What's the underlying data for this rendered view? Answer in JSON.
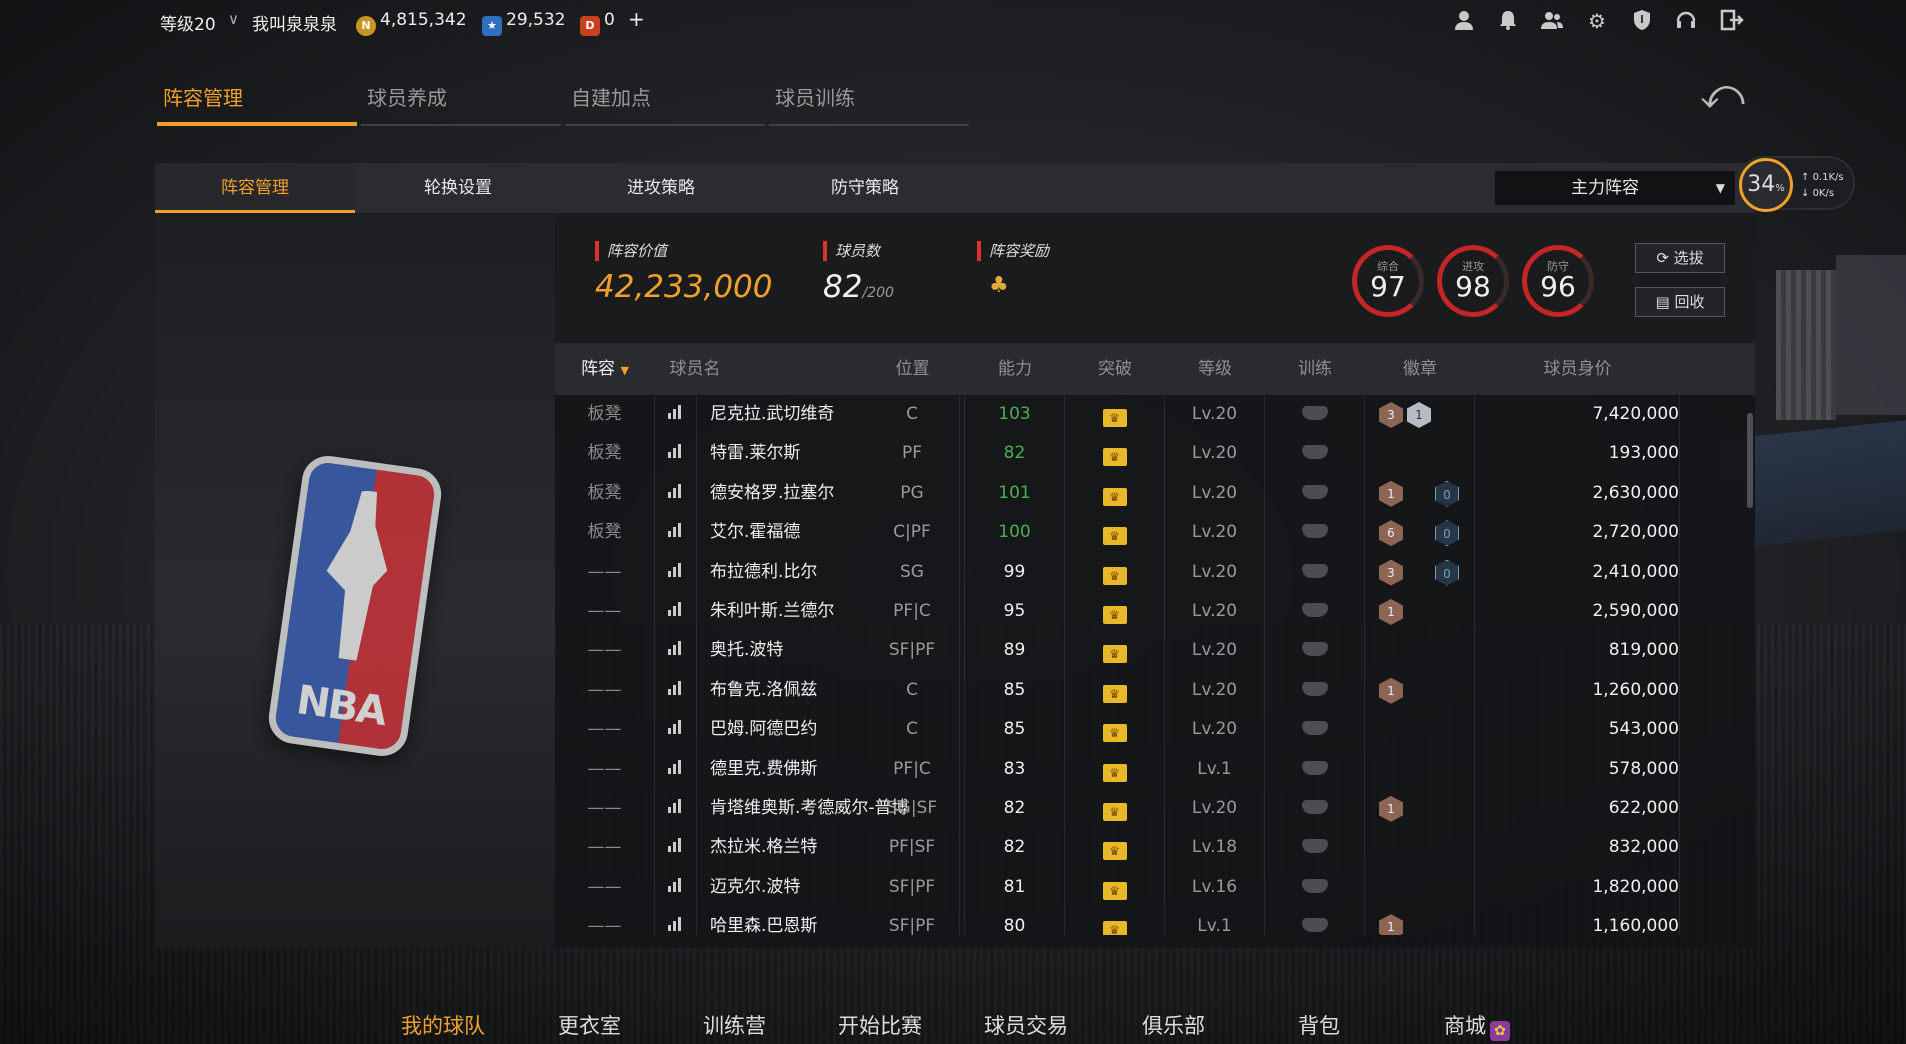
{
  "topbar": {
    "level": "等级20",
    "rank_icon": "chevron-rank-icon",
    "username": "我叫泉泉泉",
    "coins": "4,815,342",
    "stars": "29,532",
    "tickets": "0",
    "plus": "+"
  },
  "main_tabs": [
    "阵容管理",
    "球员养成",
    "自建加点",
    "球员训练"
  ],
  "sub_tabs": [
    "阵容管理",
    "轮换设置",
    "进攻策略",
    "防守策略"
  ],
  "lineup_select": "主力阵容",
  "stats": {
    "value_label": "阵容价值",
    "value": "42,233,000",
    "count_label": "球员数",
    "count": "82",
    "count_max": "/200",
    "reward_label": "阵容奖励"
  },
  "rings": [
    {
      "label": "综合",
      "value": "97"
    },
    {
      "label": "进攻",
      "value": "98"
    },
    {
      "label": "防守",
      "value": "96"
    }
  ],
  "buttons": {
    "pick": "选拔",
    "recycle": "回收"
  },
  "net": {
    "percent": "34",
    "unit": "%",
    "up": "0.1K/s",
    "down": "0K/s"
  },
  "table": {
    "headers": [
      "阵容",
      "球员名",
      "位置",
      "能力",
      "突破",
      "等级",
      "训练",
      "徽章",
      "球员身价"
    ]
  },
  "players": [
    {
      "role": "板凳",
      "name": "尼克拉.武切维奇",
      "pos": "C",
      "ability": "103",
      "green": true,
      "level": "Lv.20",
      "badges": [
        [
          "bronze",
          "3"
        ],
        [
          "silver",
          "1"
        ]
      ],
      "price": "7,420,000"
    },
    {
      "role": "板凳",
      "name": "特雷.莱尔斯",
      "pos": "PF",
      "ability": "82",
      "green": true,
      "level": "Lv.20",
      "badges": [],
      "price": "193,000"
    },
    {
      "role": "板凳",
      "name": "德安格罗.拉塞尔",
      "pos": "PG",
      "ability": "101",
      "green": true,
      "level": "Lv.20",
      "badges": [
        [
          "bronze",
          "1"
        ],
        [
          "blue",
          "0"
        ]
      ],
      "price": "2,630,000"
    },
    {
      "role": "板凳",
      "name": "艾尔.霍福德",
      "pos": "C|PF",
      "ability": "100",
      "green": true,
      "level": "Lv.20",
      "badges": [
        [
          "bronze",
          "6"
        ],
        [
          "blue",
          "0"
        ]
      ],
      "price": "2,720,000"
    },
    {
      "role": "——",
      "name": "布拉德利.比尔",
      "pos": "SG",
      "ability": "99",
      "green": false,
      "level": "Lv.20",
      "badges": [
        [
          "bronze",
          "3"
        ],
        [
          "blue",
          "0"
        ]
      ],
      "price": "2,410,000"
    },
    {
      "role": "——",
      "name": "朱利叶斯.兰德尔",
      "pos": "PF|C",
      "ability": "95",
      "green": false,
      "level": "Lv.20",
      "badges": [
        [
          "bronze",
          "1"
        ]
      ],
      "price": "2,590,000"
    },
    {
      "role": "——",
      "name": "奥托.波特",
      "pos": "SF|PF",
      "ability": "89",
      "green": false,
      "level": "Lv.20",
      "badges": [],
      "price": "819,000"
    },
    {
      "role": "——",
      "name": "布鲁克.洛佩兹",
      "pos": "C",
      "ability": "85",
      "green": false,
      "level": "Lv.20",
      "badges": [
        [
          "bronze",
          "1"
        ]
      ],
      "price": "1,260,000"
    },
    {
      "role": "——",
      "name": "巴姆.阿德巴约",
      "pos": "C",
      "ability": "85",
      "green": false,
      "level": "Lv.20",
      "badges": [],
      "price": "543,000"
    },
    {
      "role": "——",
      "name": "德里克.费佛斯",
      "pos": "PF|C",
      "ability": "83",
      "green": false,
      "level": "Lv.1",
      "badges": [],
      "price": "578,000"
    },
    {
      "role": "——",
      "name": "肯塔维奥斯.考德威尔-普博",
      "pos": "SG|SF",
      "ability": "82",
      "green": false,
      "level": "Lv.20",
      "badges": [
        [
          "bronze",
          "1"
        ]
      ],
      "price": "622,000"
    },
    {
      "role": "——",
      "name": "杰拉米.格兰特",
      "pos": "PF|SF",
      "ability": "82",
      "green": false,
      "level": "Lv.18",
      "badges": [],
      "price": "832,000"
    },
    {
      "role": "——",
      "name": "迈克尔.波特",
      "pos": "SF|PF",
      "ability": "81",
      "green": false,
      "level": "Lv.16",
      "badges": [],
      "price": "1,820,000"
    },
    {
      "role": "——",
      "name": "哈里森.巴恩斯",
      "pos": "SF|PF",
      "ability": "80",
      "green": false,
      "level": "Lv.1",
      "badges": [
        [
          "bronze",
          "1"
        ]
      ],
      "price": "1,160,000"
    }
  ],
  "bottom_nav": [
    "我的球队",
    "更衣室",
    "训练营",
    "开始比赛",
    "球员交易",
    "俱乐部",
    "背包",
    "商城"
  ],
  "colors": {
    "accent": "#f1a12b",
    "ability_green": "#4caf50",
    "ring_red": "#c42525"
  }
}
